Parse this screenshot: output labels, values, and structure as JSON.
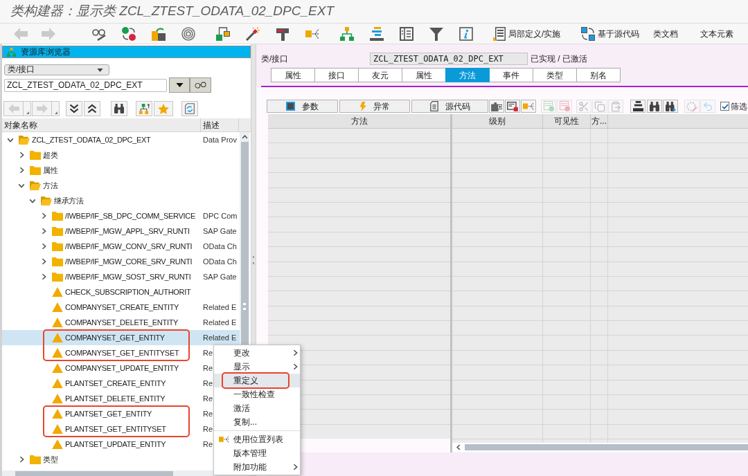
{
  "window": {
    "title": "类构建器：显示类 ZCL_ZTEST_ODATA_02_DPC_EXT"
  },
  "toolbar": {
    "nav_buttons": [
      {
        "disabled": true
      },
      {
        "disabled": true
      }
    ],
    "text_buttons": [
      "局部定义/实施",
      "基于源代码",
      "类文档",
      "文本元素"
    ]
  },
  "repository_browser": {
    "title": "资源库浏览器",
    "object_type": "类/接口",
    "object_name": "ZCL_ZTEST_ODATA_02_DPC_EXT",
    "nav_buttons": [
      {
        "disabled": true
      },
      {
        "disabled": true
      }
    ],
    "columns": [
      "对象名称",
      "描述"
    ],
    "tree": [
      {
        "kind": "folder",
        "name": "ZCL_ZTEST_ODATA_02_DPC_EXT",
        "description": "Data Prov",
        "expanded": true,
        "selected": false,
        "highlighted": false,
        "children": [
          {
            "kind": "folder",
            "name": "超类",
            "expanded": false,
            "selected": false,
            "highlighted": false
          },
          {
            "kind": "folder",
            "name": "属性",
            "expanded": false,
            "selected": false,
            "highlighted": false
          },
          {
            "kind": "folder",
            "name": "方法",
            "expanded": true,
            "selected": false,
            "highlighted": false,
            "children": [
              {
                "kind": "folder",
                "name": "继承方法",
                "expanded": true,
                "selected": false,
                "highlighted": false,
                "children": [
                  {
                    "kind": "folder",
                    "name": "/IWBEP/IF_SB_DPC_COMM_SERVICE",
                    "description": "DPC Com",
                    "expanded": false,
                    "selected": false,
                    "highlighted": false
                  },
                  {
                    "kind": "folder",
                    "name": "/IWBEP/IF_MGW_APPL_SRV_RUNTI",
                    "description": "SAP Gate",
                    "expanded": false,
                    "selected": false,
                    "highlighted": false
                  },
                  {
                    "kind": "folder",
                    "name": "/IWBEP/IF_MGW_CONV_SRV_RUNTI",
                    "description": "OData Ch",
                    "expanded": false,
                    "selected": false,
                    "highlighted": false
                  },
                  {
                    "kind": "folder",
                    "name": "/IWBEP/IF_MGW_CORE_SRV_RUNTI",
                    "description": "OData Ch",
                    "expanded": false,
                    "selected": false,
                    "highlighted": false
                  },
                  {
                    "kind": "folder",
                    "name": "/IWBEP/IF_MGW_SOST_SRV_RUNTI",
                    "description": "SAP Gate",
                    "expanded": false,
                    "selected": false,
                    "highlighted": false
                  },
                  {
                    "kind": "method",
                    "name": "CHECK_SUBSCRIPTION_AUTHORIT",
                    "selected": false,
                    "highlighted": false
                  },
                  {
                    "kind": "method",
                    "name": "COMPANYSET_CREATE_ENTITY",
                    "description": "Related E",
                    "selected": false,
                    "highlighted": false
                  },
                  {
                    "kind": "method",
                    "name": "COMPANYSET_DELETE_ENTITY",
                    "description": "Related E",
                    "selected": false,
                    "highlighted": false
                  },
                  {
                    "kind": "method",
                    "name": "COMPANYSET_GET_ENTITY",
                    "description": "Related E",
                    "selected": true,
                    "highlighted": true
                  },
                  {
                    "kind": "method",
                    "name": "COMPANYSET_GET_ENTITYSET",
                    "description": "Re",
                    "selected": false,
                    "highlighted": true
                  },
                  {
                    "kind": "method",
                    "name": "COMPANYSET_UPDATE_ENTITY",
                    "description": "Re",
                    "selected": false,
                    "highlighted": false
                  },
                  {
                    "kind": "method",
                    "name": "PLANTSET_CREATE_ENTITY",
                    "description": "Re",
                    "selected": false,
                    "highlighted": false
                  },
                  {
                    "kind": "method",
                    "name": "PLANTSET_DELETE_ENTITY",
                    "description": "Re",
                    "selected": false,
                    "highlighted": false
                  },
                  {
                    "kind": "method",
                    "name": "PLANTSET_GET_ENTITY",
                    "description": "Re",
                    "selected": false,
                    "highlighted": true
                  },
                  {
                    "kind": "method",
                    "name": "PLANTSET_GET_ENTITYSET",
                    "description": "Re",
                    "selected": false,
                    "highlighted": true
                  },
                  {
                    "kind": "method",
                    "name": "PLANTSET_UPDATE_ENTITY",
                    "description": "Re",
                    "selected": false,
                    "highlighted": false
                  }
                ]
              }
            ]
          },
          {
            "kind": "folder",
            "name": "类型",
            "expanded": false,
            "selected": false,
            "highlighted": false
          }
        ]
      }
    ]
  },
  "context_menu": {
    "groups": [
      [
        {
          "kind": "text",
          "label": "更改",
          "submenu": true,
          "selected": false,
          "highlighted": false
        },
        {
          "kind": "text",
          "label": "显示",
          "submenu": true,
          "selected": false,
          "highlighted": false
        },
        {
          "kind": "text",
          "label": "重定义",
          "submenu": false,
          "selected": true,
          "highlighted": true
        },
        {
          "kind": "text",
          "label": "一致性检查",
          "submenu": false,
          "selected": false,
          "highlighted": false
        },
        {
          "kind": "text",
          "label": "激活",
          "submenu": false,
          "selected": false,
          "highlighted": false
        },
        {
          "kind": "text",
          "label": "复制...",
          "submenu": false,
          "selected": false,
          "highlighted": false
        }
      ],
      [
        {
          "kind": "icon_text",
          "label": "使用位置列表",
          "submenu": false,
          "selected": false,
          "highlighted": false
        },
        {
          "kind": "text",
          "label": "版本管理",
          "submenu": false,
          "selected": false,
          "highlighted": false
        },
        {
          "kind": "text",
          "label": "附加功能",
          "submenu": true,
          "selected": false,
          "highlighted": false
        }
      ]
    ]
  },
  "class_editor": {
    "label": "类/接口",
    "class_name": "ZCL_ZTEST_ODATA_02_DPC_EXT",
    "status": "已实现 / 已激活",
    "tabs": [
      {
        "label": "属性",
        "selected": false
      },
      {
        "label": "接口",
        "selected": false
      },
      {
        "label": "友元",
        "selected": false
      },
      {
        "label": "属性",
        "selected": false
      },
      {
        "label": "方法",
        "selected": true
      },
      {
        "label": "事件",
        "selected": false
      },
      {
        "label": "类型",
        "selected": false
      },
      {
        "label": "别名",
        "selected": false
      }
    ],
    "toolbar": {
      "buttons": [
        "参数",
        "异常",
        "源代码"
      ],
      "icon_buttons": [
        {
          "disabled": false
        },
        {
          "disabled": false
        },
        {
          "disabled": false
        },
        {
          "disabled": true
        },
        {
          "disabled": true
        },
        {
          "disabled": true
        },
        {
          "disabled": true
        },
        {
          "disabled": true
        },
        {
          "disabled": false
        },
        {
          "disabled": false
        },
        {
          "disabled": false
        },
        {
          "disabled": true
        },
        {
          "disabled": true
        }
      ],
      "filter": {
        "label": "筛选",
        "checked": true
      }
    },
    "table": {
      "columns": [
        "方法",
        "级别",
        "可见性",
        "方..."
      ]
    }
  }
}
